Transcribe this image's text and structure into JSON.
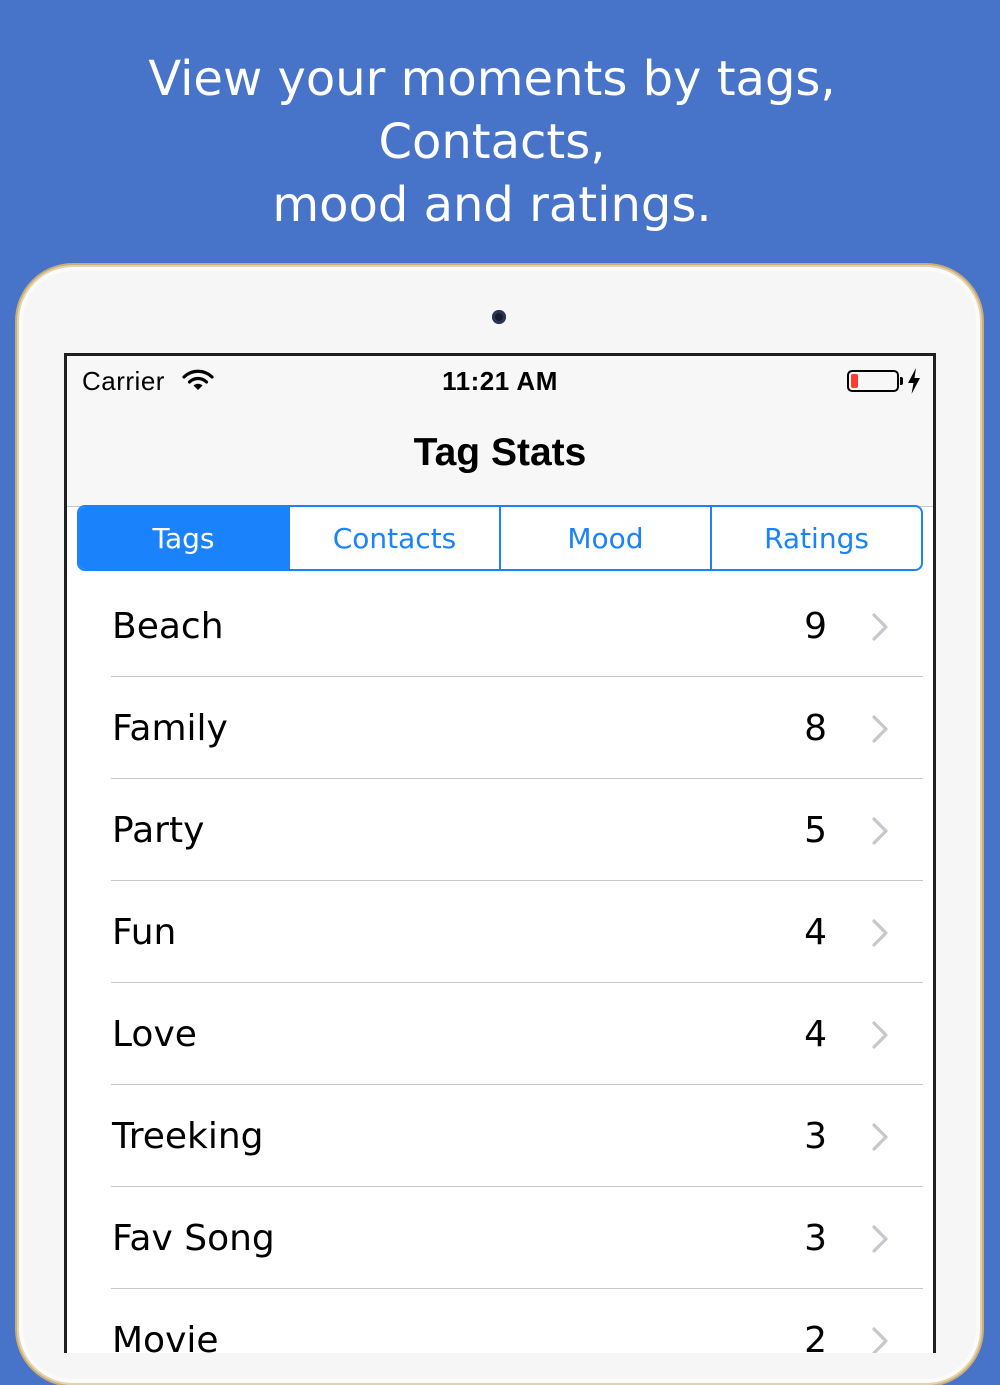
{
  "promo": {
    "line1": "View your moments by tags, Contacts,",
    "line2": "mood and ratings."
  },
  "status_bar": {
    "carrier": "Carrier",
    "time": "11:21 AM",
    "battery_level": 0.15
  },
  "nav": {
    "title": "Tag Stats"
  },
  "segments": [
    {
      "label": "Tags",
      "selected": true
    },
    {
      "label": "Contacts",
      "selected": false
    },
    {
      "label": "Mood",
      "selected": false
    },
    {
      "label": "Ratings",
      "selected": false
    }
  ],
  "rows": [
    {
      "label": "Beach",
      "count": "9"
    },
    {
      "label": "Family",
      "count": "8"
    },
    {
      "label": "Party",
      "count": "5"
    },
    {
      "label": "Fun",
      "count": "4"
    },
    {
      "label": "Love",
      "count": "4"
    },
    {
      "label": "Treeking",
      "count": "3"
    },
    {
      "label": "Fav Song",
      "count": "3"
    },
    {
      "label": "Movie",
      "count": "2"
    }
  ],
  "colors": {
    "background": "#4774c9",
    "accent": "#1a82fb",
    "battery_low": "#ff3b30"
  },
  "icons": {
    "wifi": "wifi-icon",
    "battery": "battery-icon",
    "charging": "lightning-bolt-icon",
    "disclosure": "chevron-right-icon"
  }
}
